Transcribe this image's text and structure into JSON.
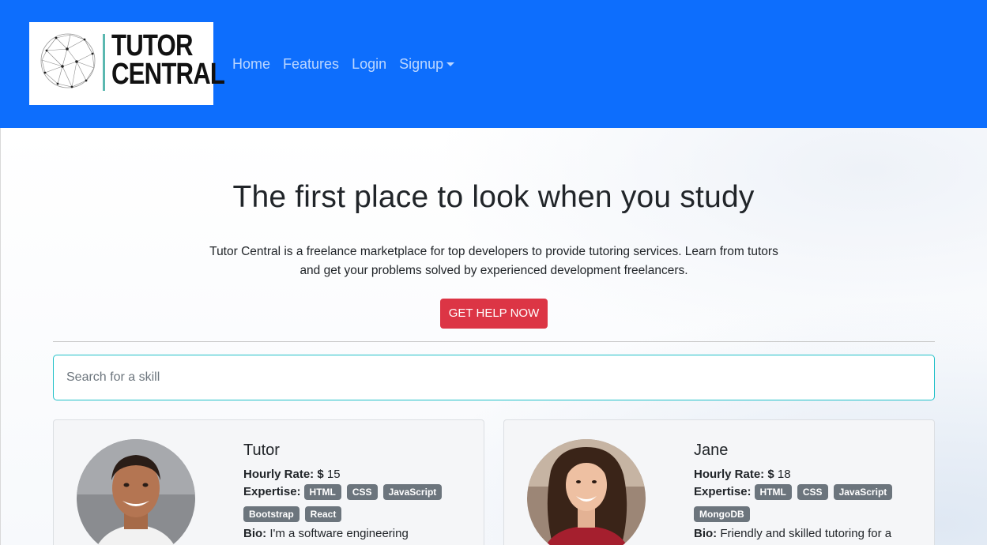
{
  "nav": {
    "brand_line1": "TUTOR",
    "brand_line2": "CENTRAL",
    "links": [
      "Home",
      "Features",
      "Login",
      "Signup"
    ]
  },
  "hero": {
    "title": "The first place to look when you study",
    "description": "Tutor Central is a freelance marketplace for top developers to provide tutoring services. Learn from tutors and get your problems solved by experienced development freelancers.",
    "cta_label": "GET HELP NOW"
  },
  "search": {
    "placeholder": "Search for a skill"
  },
  "labels": {
    "hourly_rate": "Hourly Rate:",
    "expertise": "Expertise:",
    "bio": "Bio:",
    "currency": "$"
  },
  "tutors": [
    {
      "name": "Tutor",
      "rate": "15",
      "skills": [
        "HTML",
        "CSS",
        "JavaScript",
        "Bootstrap",
        "React"
      ],
      "bio": "I'm a software engineering"
    },
    {
      "name": "Jane",
      "rate": "18",
      "skills": [
        "HTML",
        "CSS",
        "JavaScript",
        "MongoDB"
      ],
      "bio": "Friendly and skilled tutoring for a"
    }
  ],
  "colors": {
    "navbar": "#0d6efd",
    "cta": "#dc3545",
    "badge": "#6c757d",
    "search_border": "#20c0c8"
  }
}
